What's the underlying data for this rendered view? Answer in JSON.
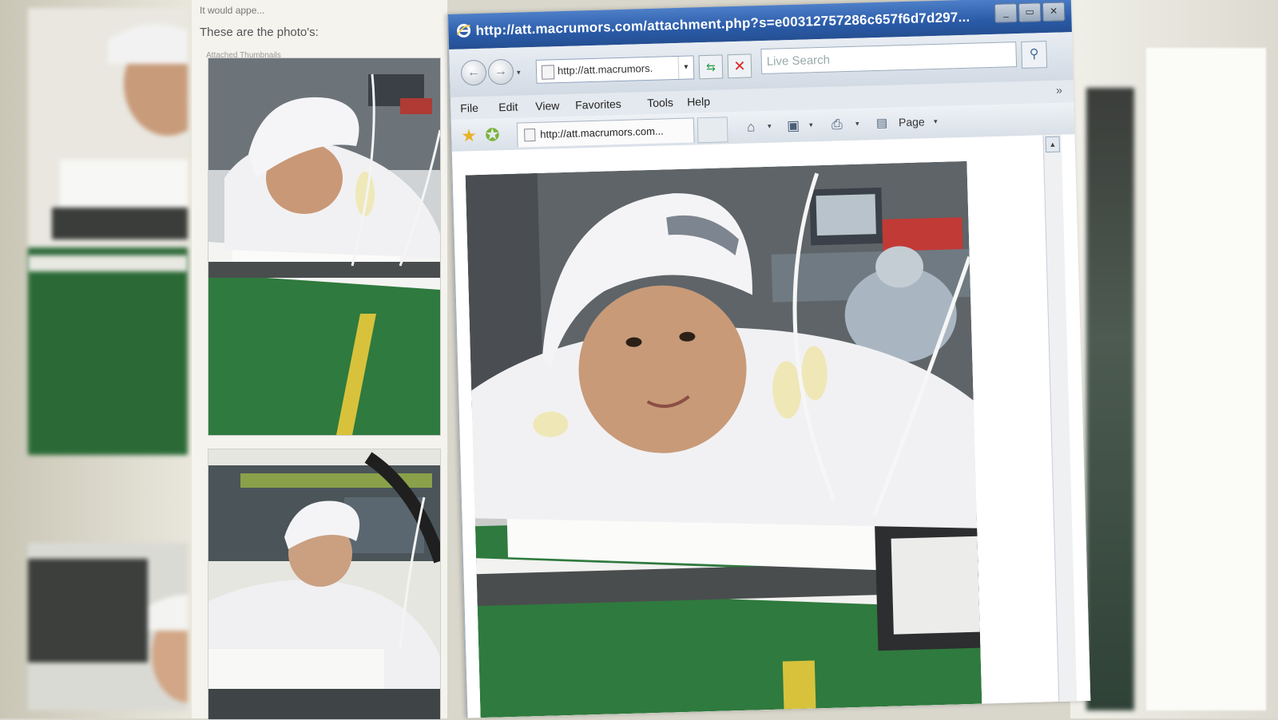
{
  "forum": {
    "fragment_text": "It would appe...",
    "intro_text": "These are the photo's:",
    "attachments_label": "Attached Thumbnails"
  },
  "browser": {
    "title": "http://att.macrumors.com/attachment.php?s=e00312757286c657f6d7d297...",
    "address": "http://att.macrumors.",
    "search_placeholder": "Live Search",
    "menu": [
      "File",
      "Edit",
      "View",
      "Favorites",
      "Tools",
      "Help"
    ],
    "tab_label": "http://att.macrumors.com...",
    "page_menu_label": "Page",
    "menu_overflow": "»"
  },
  "icons": {
    "browser_logo": "ie-logo-icon",
    "back": "back-arrow-icon",
    "forward": "forward-arrow-icon",
    "refresh": "refresh-icon",
    "stop": "stop-icon",
    "search": "magnifier-icon",
    "favorites": "favorites-star-icon",
    "add_favorite": "add-favorite-icon",
    "home": "home-icon",
    "feeds": "feeds-icon",
    "print": "print-icon",
    "page": "page-icon"
  },
  "colors": {
    "titlebar": "#2a5ba8",
    "chrome": "#d8dde4",
    "conveyor_green": "#2f7a3e",
    "stop_red": "#dd2222"
  }
}
